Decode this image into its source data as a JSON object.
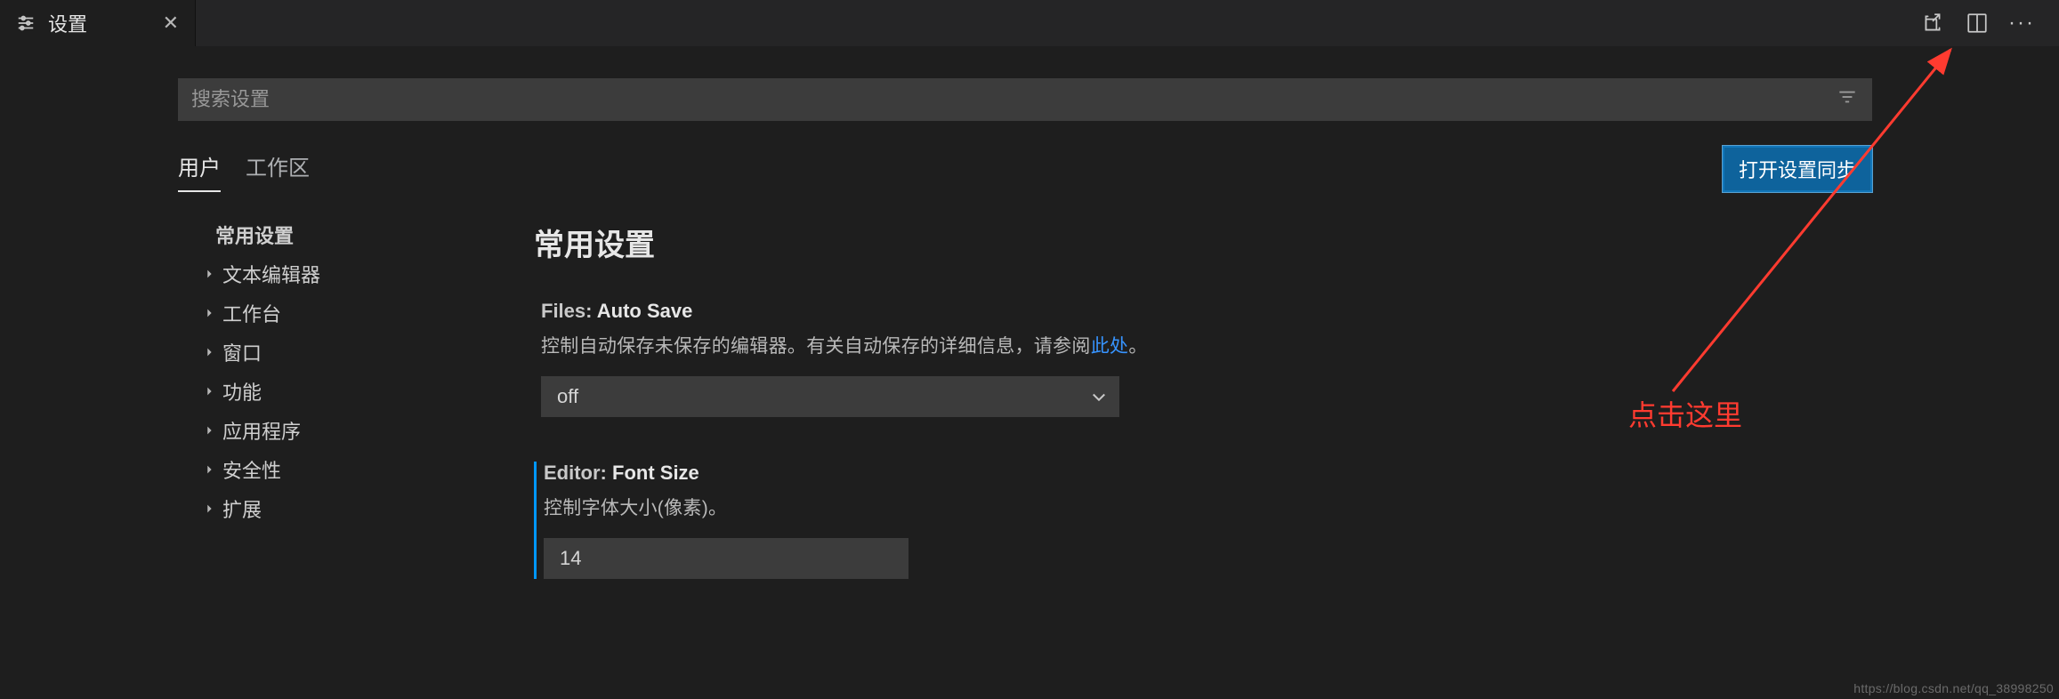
{
  "tab": {
    "title": "设置"
  },
  "search": {
    "placeholder": "搜索设置"
  },
  "scopes": {
    "user": "用户",
    "workspace": "工作区"
  },
  "sync_button": "打开设置同步",
  "tree": {
    "top": "常用设置",
    "items": [
      "文本编辑器",
      "工作台",
      "窗口",
      "功能",
      "应用程序",
      "安全性",
      "扩展"
    ]
  },
  "section_title": "常用设置",
  "settings": {
    "autosave": {
      "prefix": "Files:",
      "name": "Auto Save",
      "desc_pre": "控制自动保存未保存的编辑器。有关自动保存的详细信息，请参阅",
      "desc_link": "此处",
      "desc_post": "。",
      "value": "off"
    },
    "fontsize": {
      "prefix": "Editor:",
      "name": "Font Size",
      "desc": "控制字体大小(像素)。",
      "value": "14"
    }
  },
  "annotation": "点击这里",
  "watermark": "https://blog.csdn.net/qq_38998250"
}
